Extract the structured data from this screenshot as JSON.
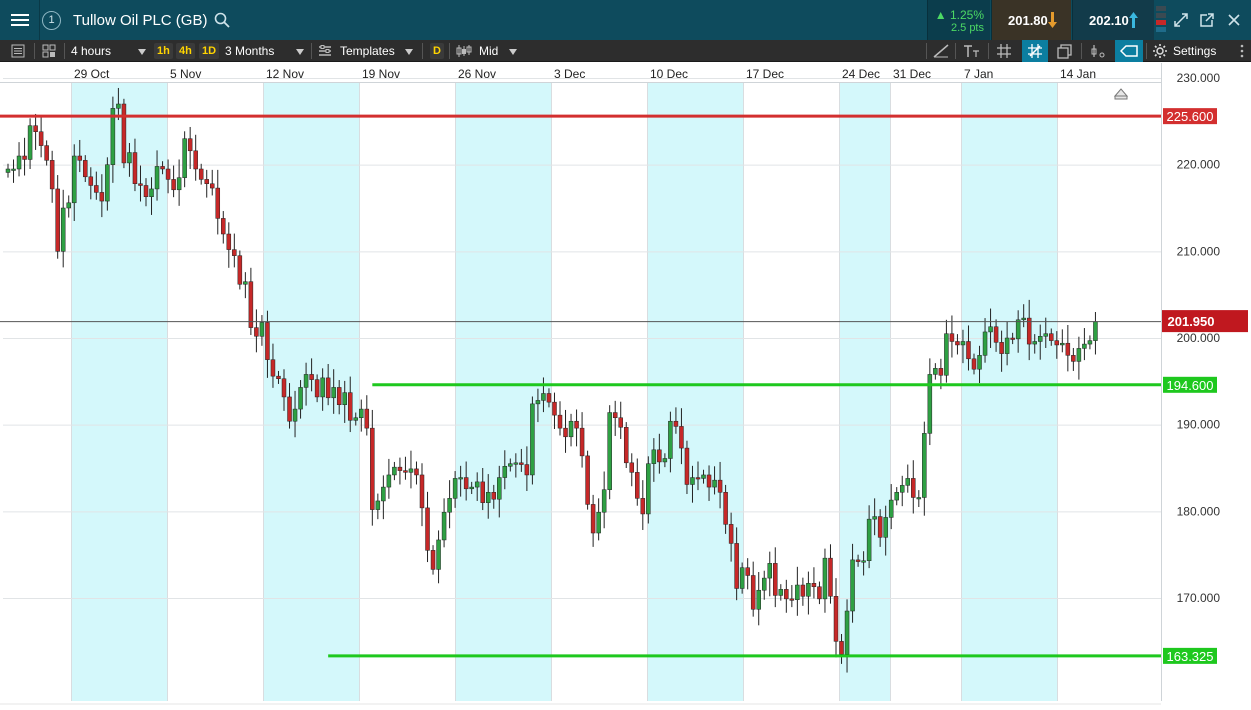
{
  "titlebar": {
    "link_number": "1",
    "instrument": "Tullow Oil PLC (GB)",
    "change_percent": "▲ 1.25%",
    "change_points": "2.5 pts",
    "sell_price": "201.80",
    "buy_price": "202.10"
  },
  "toolbar": {
    "interval": "4 hours",
    "quick_intervals": [
      "1h",
      "4h",
      "1D"
    ],
    "period": "3 Months",
    "templates": "Templates",
    "d_badge": "D",
    "price_type": "Mid",
    "settings": "Settings"
  },
  "colors": {
    "up": "#2ea043",
    "down": "#c62828",
    "resistance": "#d32f2f",
    "support": "#1ec81e",
    "last_price_tag": "#c0181f",
    "band": "#d4f8fb"
  },
  "chart_data": {
    "type": "candlestick",
    "instrument": "Tullow Oil PLC (GB)",
    "interval": "4 hours",
    "x_tick_labels": [
      "29 Oct",
      "5 Nov",
      "12 Nov",
      "19 Nov",
      "26 Nov",
      "3 Dec",
      "10 Dec",
      "17 Dec",
      "24 Dec",
      "31 Dec",
      "7 Jan",
      "14 Jan"
    ],
    "y_tick_labels": [
      "230.000",
      "220.000",
      "210.000",
      "200.000",
      "190.000",
      "180.000",
      "170.000"
    ],
    "ylim": [
      161.5,
      231
    ],
    "last_price": 201.95,
    "last_price_label": "201.950",
    "horizontal_lines": [
      {
        "value": 225.6,
        "label": "225.600",
        "color": "#d32f2f",
        "from_start": true
      },
      {
        "value": 194.6,
        "label": "194.600",
        "color": "#1ec81e",
        "from_date_index": 66
      },
      {
        "value": 163.325,
        "label": "163.325",
        "color": "#1ec81e",
        "from_date_index": 58
      }
    ],
    "closes": [
      219.5,
      219.5,
      221,
      220.6,
      224.5,
      223.8,
      222.2,
      220.5,
      217.2,
      210,
      215,
      215.6,
      221,
      220.5,
      218.6,
      217.6,
      216.8,
      215.8,
      220,
      226.5,
      227,
      220.2,
      221.4,
      217.8,
      217.6,
      216.3,
      217.2,
      219.8,
      219.5,
      218.3,
      217.1,
      218.5,
      223,
      221.6,
      219.5,
      218.3,
      217.8,
      217.3,
      213.8,
      212,
      210.2,
      209.5,
      206.2,
      206.5,
      201.2,
      200.2,
      201.8,
      197.5,
      195.6,
      195.3,
      193.2,
      190.4,
      191.8,
      194.3,
      195.8,
      195.2,
      193.2,
      195.4,
      193.1,
      194.3,
      192.3,
      193.7,
      190.5,
      190.8,
      191.8,
      189.6,
      180.2,
      181.2,
      182.8,
      184.2,
      185.1,
      184.7,
      184.5,
      184.9,
      184.2,
      180.4,
      175.5,
      173.3,
      176.7,
      179.9,
      181.5,
      183.8,
      183.9,
      182.6,
      182.8,
      183.4,
      181,
      182.2,
      181.4,
      183.9,
      185.2,
      185.5,
      185.6,
      185.4,
      184.2,
      192.4,
      192.8,
      193.6,
      192.6,
      191.1,
      189.6,
      188.6,
      190.4,
      189.6,
      186.4,
      180.8,
      177.5,
      179.9,
      182.5,
      191.4,
      190.8,
      189.7,
      185.6,
      184.5,
      181.5,
      179.7,
      185.5,
      187.1,
      185.7,
      186.1,
      190.4,
      189.8,
      187.3,
      183.1,
      183.9,
      183.8,
      184.2,
      182.8,
      183.6,
      182.2,
      178.5,
      176.3,
      171.1,
      173.5,
      172.6,
      168.7,
      170.9,
      172.3,
      174,
      170.3,
      171,
      169.9,
      169.8,
      171.5,
      170.2,
      171.7,
      171.3,
      169.9,
      174.6,
      170.2,
      165,
      163.5,
      168.5,
      174.4,
      174.2,
      174.3,
      179.1,
      179.4,
      177,
      179.3,
      181.3,
      182.2,
      183,
      183.8,
      181.6,
      181.6,
      189,
      195.8,
      196.5,
      195.7,
      200.5,
      199.6,
      199.2,
      199.6,
      197.6,
      196.4,
      198,
      200.7,
      201.3,
      199.5,
      198.2,
      200,
      199.9,
      202.1,
      202.3,
      199.3,
      199.6,
      200.2,
      200.5,
      199.7,
      199.2,
      199.4,
      198,
      197.3,
      198.8,
      199.3,
      199.7,
      201.9
    ]
  }
}
